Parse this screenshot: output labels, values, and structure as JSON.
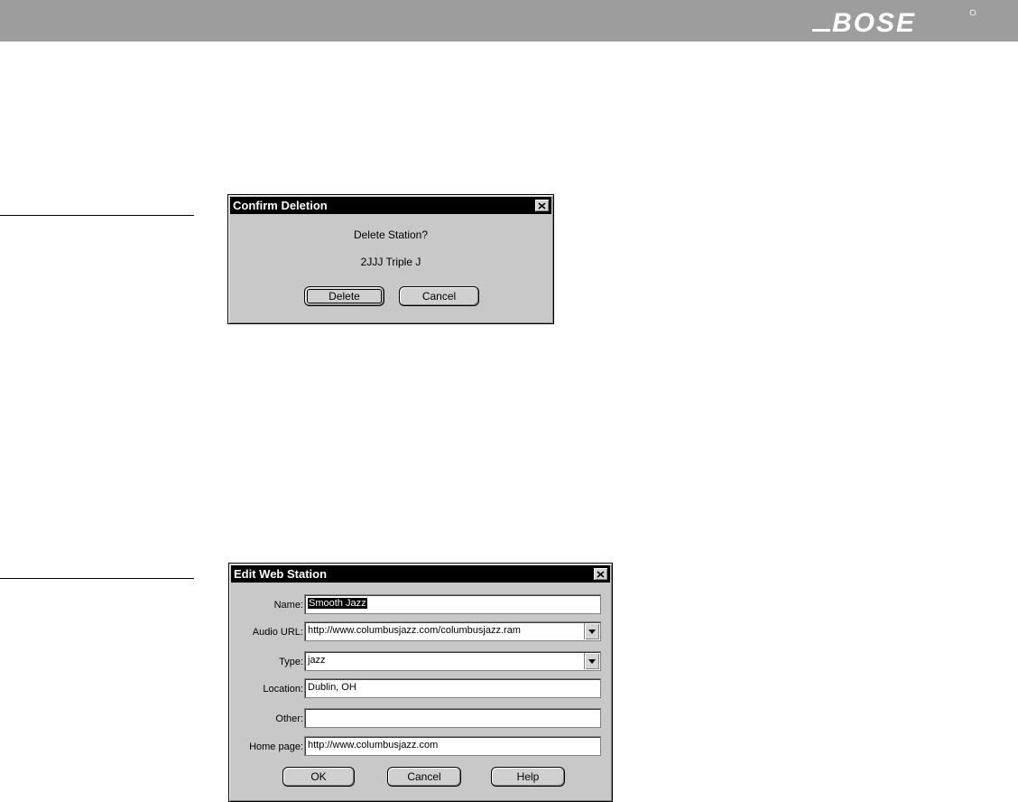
{
  "brand": {
    "name": "BOSE"
  },
  "confirm_dialog": {
    "title": "Confirm Deletion",
    "message": "Delete Station?",
    "station": "2JJJ Triple J",
    "buttons": {
      "delete": "Delete",
      "cancel": "Cancel"
    }
  },
  "edit_dialog": {
    "title": "Edit Web Station",
    "fields": {
      "name": {
        "label": "Name:",
        "value": "Smooth Jazz"
      },
      "audio_url": {
        "label": "Audio URL:",
        "value": "http://www.columbusjazz.com/columbusjazz.ram"
      },
      "type": {
        "label": "Type:",
        "value": "jazz"
      },
      "location": {
        "label": "Location:",
        "value": "Dublin, OH"
      },
      "other": {
        "label": "Other:",
        "value": ""
      },
      "home_page": {
        "label": "Home page:",
        "value": "http://www.columbusjazz.com"
      }
    },
    "buttons": {
      "ok": "OK",
      "cancel": "Cancel",
      "help": "Help"
    }
  },
  "colors": {
    "header": "#9d9d9d",
    "dialog_face": "#c8c8c8",
    "titlebar": "#000000"
  },
  "icons": [
    "close-icon",
    "chevron-down-icon",
    "bose-logo"
  ]
}
